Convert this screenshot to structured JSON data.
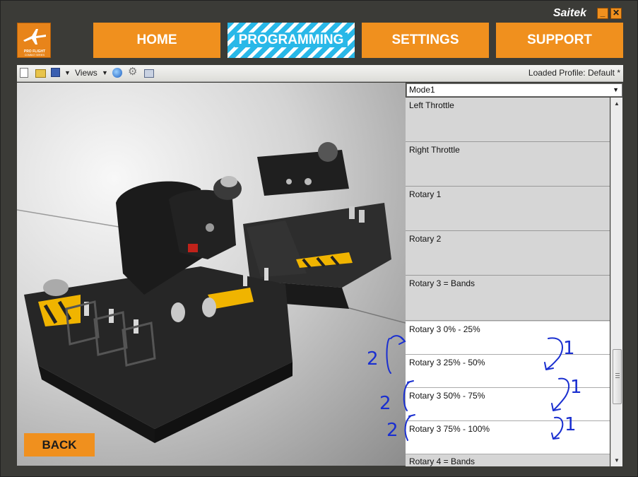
{
  "window": {
    "brand": "Saitek",
    "minimize_glyph": "_",
    "close_glyph": "✕"
  },
  "logo": {
    "line1": "PRO FLIGHT",
    "line2": "COMBAT SERIES",
    "icon": "jet-icon"
  },
  "nav": {
    "home": "HOME",
    "programming": "PROGRAMMING",
    "settings": "SETTINGS",
    "support": "SUPPORT",
    "active": "PROGRAMMING"
  },
  "toolbar": {
    "views_label": "Views",
    "dropdown_glyph": "▼",
    "gear_glyph": "⚙",
    "profile_text": "Loaded Profile: Default *",
    "icons": [
      "new-file-icon",
      "open-folder-icon",
      "save-icon",
      "globe-icon",
      "gear-icon",
      "print-icon"
    ]
  },
  "back_button": "BACK",
  "mode_select": {
    "value": "Mode1",
    "arrow_glyph": "▼"
  },
  "control_list": {
    "items": [
      {
        "label": "Left Throttle"
      },
      {
        "label": "Right Throttle"
      },
      {
        "label": "Rotary 1"
      },
      {
        "label": "Rotary 2"
      },
      {
        "label": "Rotary 3 = Bands"
      },
      {
        "label": "Rotary 3 0% - 25%"
      },
      {
        "label": "Rotary 3 25% - 50%"
      },
      {
        "label": "Rotary 3 50% - 75%"
      },
      {
        "label": "Rotary 3 75% - 100%"
      },
      {
        "label": "Rotary 4 = Bands"
      }
    ]
  },
  "scrollbar": {
    "up_glyph": "▲",
    "down_glyph": "▼"
  },
  "annotations": {
    "color": "#1a2fd0",
    "labels": [
      "2",
      "1",
      "2",
      "1",
      "2",
      "1"
    ]
  },
  "colors": {
    "accent_orange": "#f0901e",
    "active_blue": "#29b8e8",
    "background": "#3b3b37"
  }
}
